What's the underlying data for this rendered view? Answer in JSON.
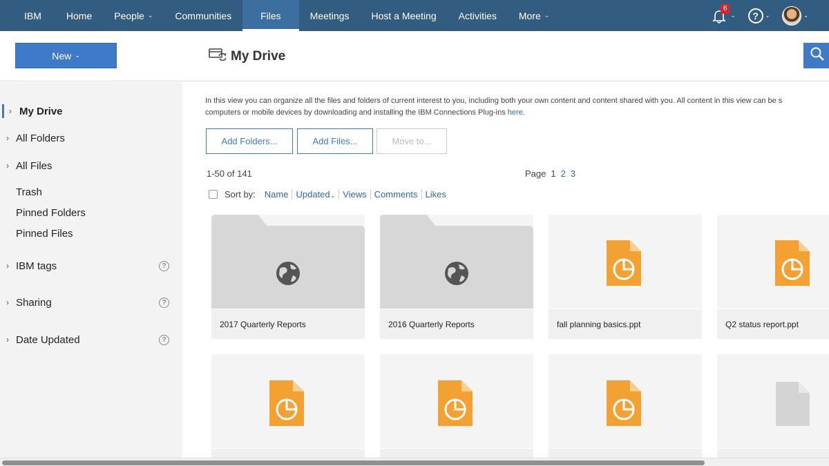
{
  "nav": {
    "items": [
      {
        "label": "IBM",
        "chevron": false
      },
      {
        "label": "Home",
        "chevron": false
      },
      {
        "label": "People",
        "chevron": true
      },
      {
        "label": "Communities",
        "chevron": false
      },
      {
        "label": "Files",
        "chevron": false,
        "active": true
      },
      {
        "label": "Meetings",
        "chevron": false
      },
      {
        "label": "Host a Meeting",
        "chevron": false
      },
      {
        "label": "Activities",
        "chevron": false
      },
      {
        "label": "More",
        "chevron": true
      }
    ],
    "notification_count": "6",
    "help_glyph": "?",
    "chevron_glyph": "⌄",
    "brand_color": "#325c80"
  },
  "header": {
    "new_label": "New",
    "chevron_glyph": "⌄",
    "title": "My Drive",
    "accent_color": "#3f7ac9"
  },
  "sidebar": {
    "items": [
      {
        "label": "My Drive",
        "arrow": "›",
        "active": true
      },
      {
        "label": "All Folders",
        "arrow": "›"
      },
      {
        "label": "All Files",
        "arrow": "›"
      },
      {
        "label": "Trash",
        "arrow": ""
      },
      {
        "label": "Pinned Folders",
        "arrow": ""
      },
      {
        "label": "Pinned Files",
        "arrow": ""
      },
      {
        "label": "IBM tags",
        "arrow": "›",
        "help": "?"
      },
      {
        "label": "Sharing",
        "arrow": "›",
        "help": "?"
      },
      {
        "label": "Date Updated",
        "arrow": "›",
        "help": "?"
      }
    ]
  },
  "main": {
    "intro_line1": "In this view you can organize all the files and folders of current interest to you, including both your own content and content shared with you. All content in this view can be s",
    "intro_line2": "computers or mobile devices by downloading and installing the IBM Connections Plug-ins ",
    "intro_link": "here.",
    "buttons": {
      "add_folders": "Add Folders...",
      "add_files": "Add Files...",
      "move_to": "Move to..."
    },
    "count": "1-50 of 141",
    "pager": {
      "label": "Page",
      "current": "1",
      "pages": [
        "2",
        "3"
      ]
    },
    "sort": {
      "label": "Sort by:",
      "options": [
        "Name",
        "Updated",
        "Views",
        "Comments",
        "Likes"
      ],
      "active_chevron": "⌄"
    },
    "cards": [
      {
        "name": "2017 Quarterly Reports",
        "kind": "folder"
      },
      {
        "name": "2016 Quarterly Reports",
        "kind": "folder"
      },
      {
        "name": "fall planning basics.ppt",
        "kind": "presentation"
      },
      {
        "name": "Q2 status report.ppt",
        "kind": "presentation"
      },
      {
        "name": "",
        "kind": "presentation"
      },
      {
        "name": "",
        "kind": "presentation"
      },
      {
        "name": "",
        "kind": "presentation"
      },
      {
        "name": "",
        "kind": "generic-file"
      }
    ],
    "colors": {
      "presentation": "#f4a134",
      "folder": "#d7d7d7",
      "link": "#2f6aa8"
    }
  }
}
